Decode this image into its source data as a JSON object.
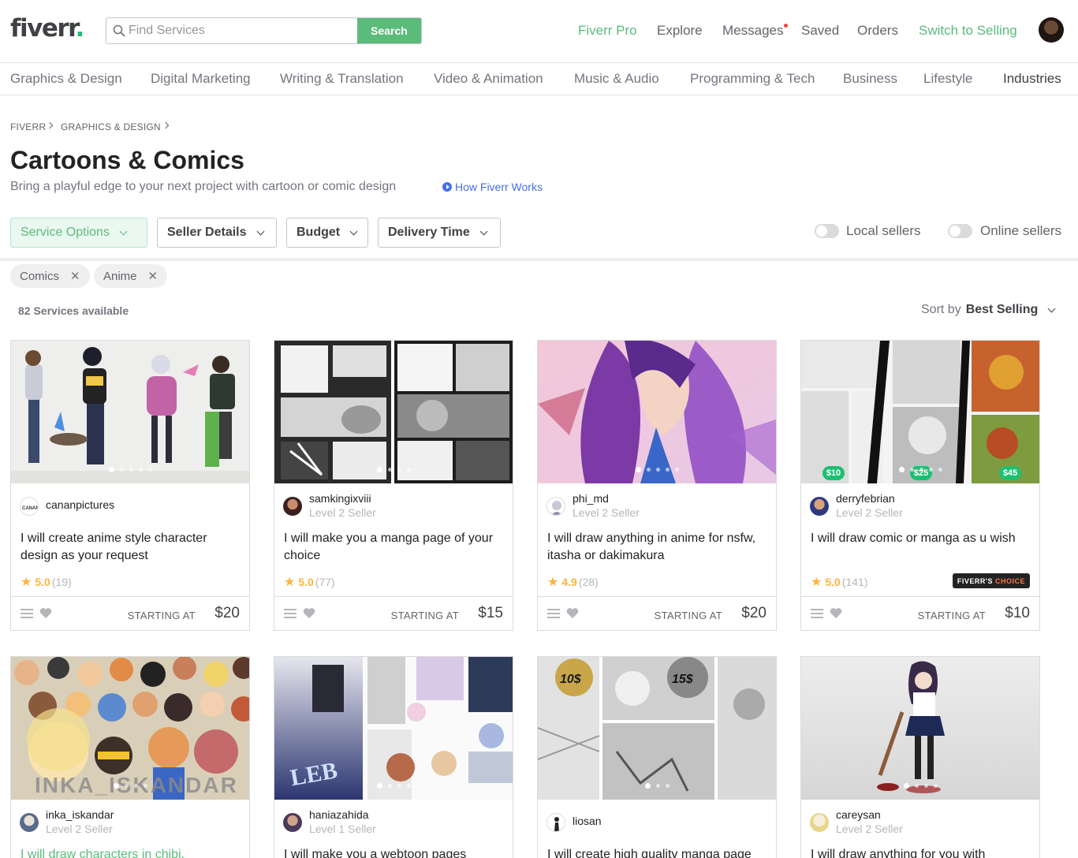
{
  "header": {
    "logo": "fiverr",
    "search_placeholder": "Find Services",
    "search_button": "Search",
    "nav": {
      "pro": "Fiverr Pro",
      "explore": "Explore",
      "messages": "Messages",
      "saved": "Saved",
      "orders": "Orders",
      "switch": "Switch to Selling"
    }
  },
  "categories": [
    "Graphics & Design",
    "Digital Marketing",
    "Writing & Translation",
    "Video & Animation",
    "Music & Audio",
    "Programming & Tech",
    "Business",
    "Lifestyle",
    "Industries"
  ],
  "breadcrumb": [
    "FIVERR",
    "GRAPHICS & DESIGN"
  ],
  "page": {
    "title": "Cartoons & Comics",
    "subtitle": "Bring a playful edge to your next project with cartoon or comic design",
    "how_link": "How Fiverr Works"
  },
  "filters": {
    "service_options": "Service Options",
    "seller_details": "Seller Details",
    "budget": "Budget",
    "delivery_time": "Delivery Time",
    "local_sellers": "Local sellers",
    "online_sellers": "Online sellers"
  },
  "tags": [
    "Comics",
    "Anime"
  ],
  "results": {
    "count": "82 Services available",
    "sort_label": "Sort by",
    "sort_value": "Best Selling"
  },
  "gigs": [
    {
      "seller": "cananpictures",
      "level": "",
      "title": "I will create anime style character design as your request",
      "rating": "5.0",
      "reviews": "(19)",
      "starting": "STARTING AT",
      "price": "$20",
      "choice": ""
    },
    {
      "seller": "samkingixviii",
      "level": "Level 2 Seller",
      "title": "I will make you a manga page of your choice",
      "rating": "5.0",
      "reviews": "(77)",
      "starting": "STARTING AT",
      "price": "$15",
      "choice": ""
    },
    {
      "seller": "phi_md",
      "level": "Level 2 Seller",
      "title": "I will draw anything in anime for nsfw, itasha or dakimakura",
      "rating": "4.9",
      "reviews": "(28)",
      "starting": "STARTING AT",
      "price": "$20",
      "choice": ""
    },
    {
      "seller": "derryfebrian",
      "level": "Level 2 Seller",
      "title": "I will draw comic or manga as u wish",
      "rating": "5.0",
      "reviews": "(141)",
      "starting": "STARTING AT",
      "price": "$10",
      "choice": "FIVERR'S",
      "choice_accent": "CHOICE",
      "badges": [
        "$10",
        "$25",
        "$45"
      ]
    },
    {
      "seller": "inka_iskandar",
      "level": "Level 2 Seller",
      "title": "I will draw characters in chibi,"
    },
    {
      "seller": "haniazahida",
      "level": "Level 1 Seller",
      "title": "I will make you a webtoon pages"
    },
    {
      "seller": "liosan",
      "level": "",
      "title": "I will create high quality manga page"
    },
    {
      "seller": "careysan",
      "level": "Level 2 Seller",
      "title": "I will draw anything for you with"
    }
  ],
  "colors": {
    "brand_green": "#1dbf73",
    "accent_green": "#5bbb7b",
    "text": "#404145",
    "muted": "#74767e",
    "link_blue": "#446ee7",
    "star": "#ffb33e"
  }
}
